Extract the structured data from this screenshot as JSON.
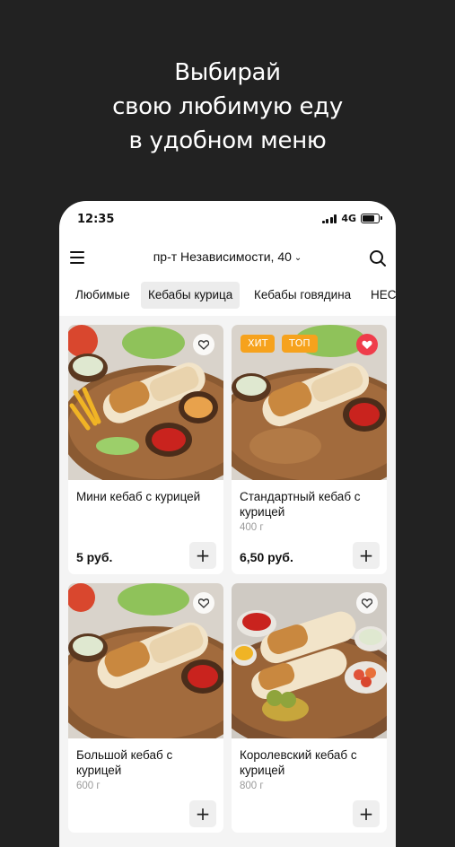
{
  "promo": {
    "lines": [
      "Выбирай",
      "свою любимую еду",
      "в удобном меню"
    ]
  },
  "status_bar": {
    "time": "12:35",
    "network": "4G"
  },
  "header": {
    "address": "пр-т Независимости, 40",
    "icons": [
      "hamburger-menu-icon",
      "chevron-down-icon",
      "search-icon"
    ]
  },
  "tabs": [
    {
      "label": "Любимые",
      "active": false
    },
    {
      "label": "Кебабы курица",
      "active": true
    },
    {
      "label": "Кебабы говядина",
      "active": false
    },
    {
      "label": "НЕС",
      "active": false
    }
  ],
  "products": [
    {
      "title": "Мини кебаб с курицей",
      "weight": "",
      "price": "5 руб.",
      "badges": [],
      "favorite": false
    },
    {
      "title": "Стандартный кебаб с курицей",
      "weight": "400 г",
      "price": "6,50 руб.",
      "badges": [
        "ХИТ",
        "ТОП"
      ],
      "favorite": true
    },
    {
      "title": "Большой кебаб с курицей",
      "weight": "600 г",
      "price": "",
      "badges": [],
      "favorite": false
    },
    {
      "title": "Королевский кебаб с курицей",
      "weight": "800 г",
      "price": "",
      "badges": [],
      "favorite": false
    }
  ],
  "colors": {
    "background": "#222222",
    "badge": "#f6a21d",
    "favorite_active": "#ef3d4b",
    "active_tab": "#ececec"
  },
  "add_label": "+"
}
